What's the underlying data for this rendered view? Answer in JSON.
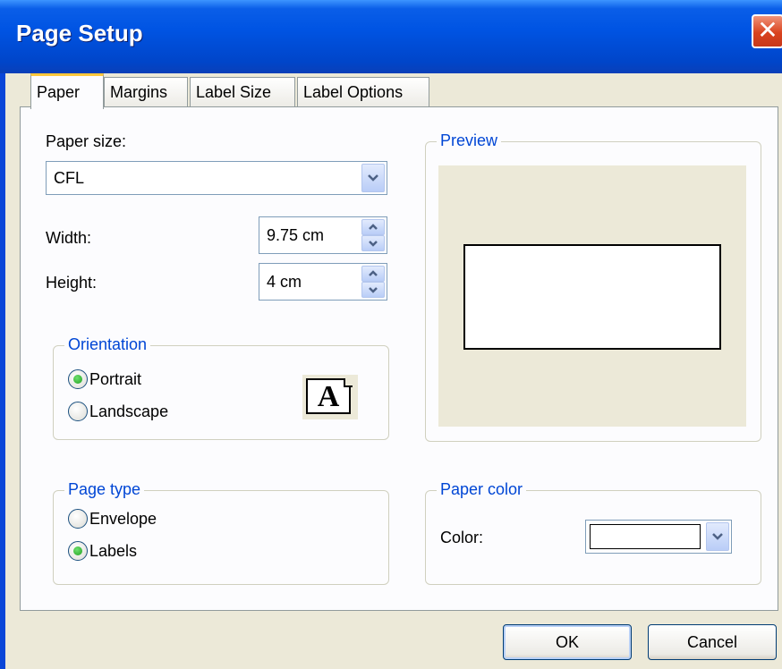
{
  "window": {
    "title": "Page Setup",
    "close_symbol": "✕"
  },
  "tabs": [
    "Paper",
    "Margins",
    "Label Size",
    "Label Options"
  ],
  "paper_size": {
    "label": "Paper size:",
    "value": "CFL"
  },
  "width": {
    "label": "Width:",
    "value": "9.75 cm"
  },
  "height": {
    "label": "Height:",
    "value": "4 cm"
  },
  "orientation": {
    "title": "Orientation",
    "options": [
      "Portrait",
      "Landscape"
    ],
    "selected": "Portrait",
    "icon_letter": "A"
  },
  "preview": {
    "title": "Preview"
  },
  "page_type": {
    "title": "Page type",
    "options": [
      "Envelope",
      "Labels"
    ],
    "selected": "Labels"
  },
  "paper_color": {
    "title": "Paper color",
    "label": "Color:",
    "value": "#ffffff"
  },
  "buttons": {
    "ok": "OK",
    "cancel": "Cancel"
  },
  "colors": {
    "title_bar": "#0054e3",
    "group_title": "#0046d5",
    "radio_selected": "#21a121"
  }
}
